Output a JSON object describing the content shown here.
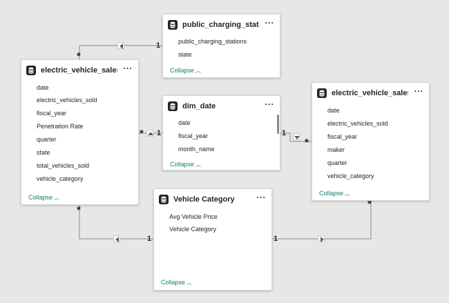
{
  "tables": {
    "public_charging": {
      "title": "public_charging_station",
      "fields": [
        "public_charging_stations",
        "state"
      ],
      "collapse": "Collapse"
    },
    "ev_sales_state": {
      "title": "electric_vehicle_sales_b...",
      "fields": [
        "date",
        "electric_vehicles_sold",
        "fiscal_year",
        "Penetration Rate",
        "quarter",
        "state",
        "total_vehicles_sold",
        "vehicle_category"
      ],
      "collapse": "Collapse"
    },
    "dim_date": {
      "title": "dim_date",
      "fields": [
        "date",
        "fiscal_year",
        "month_name"
      ],
      "collapse": "Collapse"
    },
    "ev_sales_maker": {
      "title": "electric_vehicle_sales_b...",
      "fields": [
        "date",
        "electric_vehicles_sold",
        "fiscal_year",
        "maker",
        "quarter",
        "vehicle_category"
      ],
      "collapse": "Collapse"
    },
    "vehicle_category": {
      "title": "Vehicle Category",
      "fields": [
        "Avg Vehicle Price",
        "Vehicle Category"
      ],
      "collapse": "Collapse"
    }
  },
  "more_label": "···",
  "relationships": {
    "one": "1",
    "many": "*"
  },
  "colors": {
    "canvas": "#e7e7e7",
    "collapse_link": "#127a6b",
    "line": "#8a8886"
  },
  "icons": {
    "table": "table-icon",
    "collapse": "chevron-up-icon",
    "direction": "triangle-arrow-icon"
  }
}
